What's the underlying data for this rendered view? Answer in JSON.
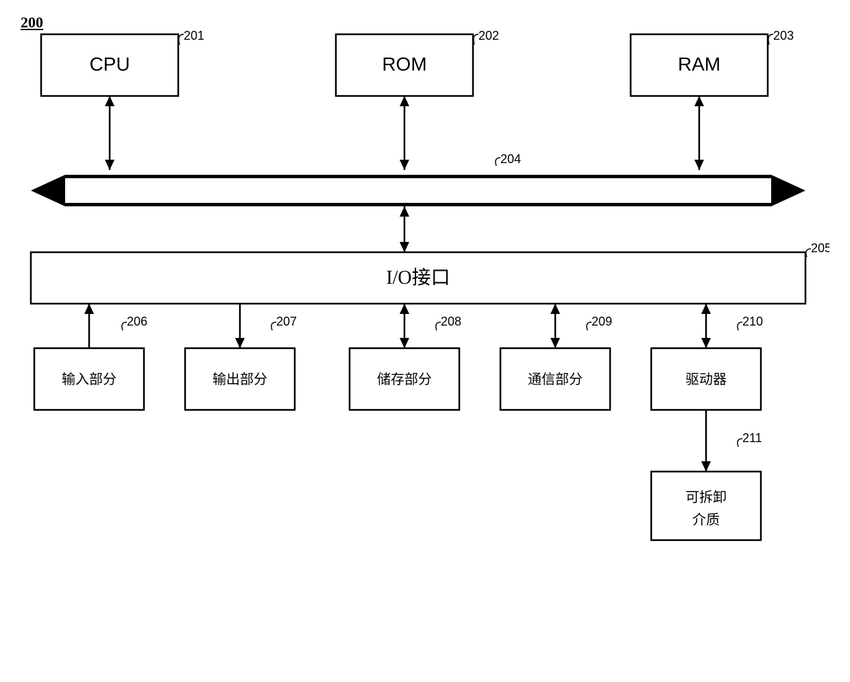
{
  "title": "200",
  "components": {
    "cpu": {
      "label": "CPU",
      "ref": "201"
    },
    "rom": {
      "label": "ROM",
      "ref": "202"
    },
    "ram": {
      "label": "RAM",
      "ref": "203"
    },
    "bus": {
      "ref": "204"
    },
    "io": {
      "label": "I/O接口",
      "ref": "205"
    },
    "input": {
      "label": "输入部分",
      "ref": "206"
    },
    "output": {
      "label": "输出部分",
      "ref": "207"
    },
    "storage": {
      "label": "储存部分",
      "ref": "208"
    },
    "comm": {
      "label": "通信部分",
      "ref": "209"
    },
    "driver": {
      "label": "驱动器",
      "ref": "210"
    },
    "removable": {
      "label": "可拆卸\n介质",
      "ref": "211"
    }
  }
}
